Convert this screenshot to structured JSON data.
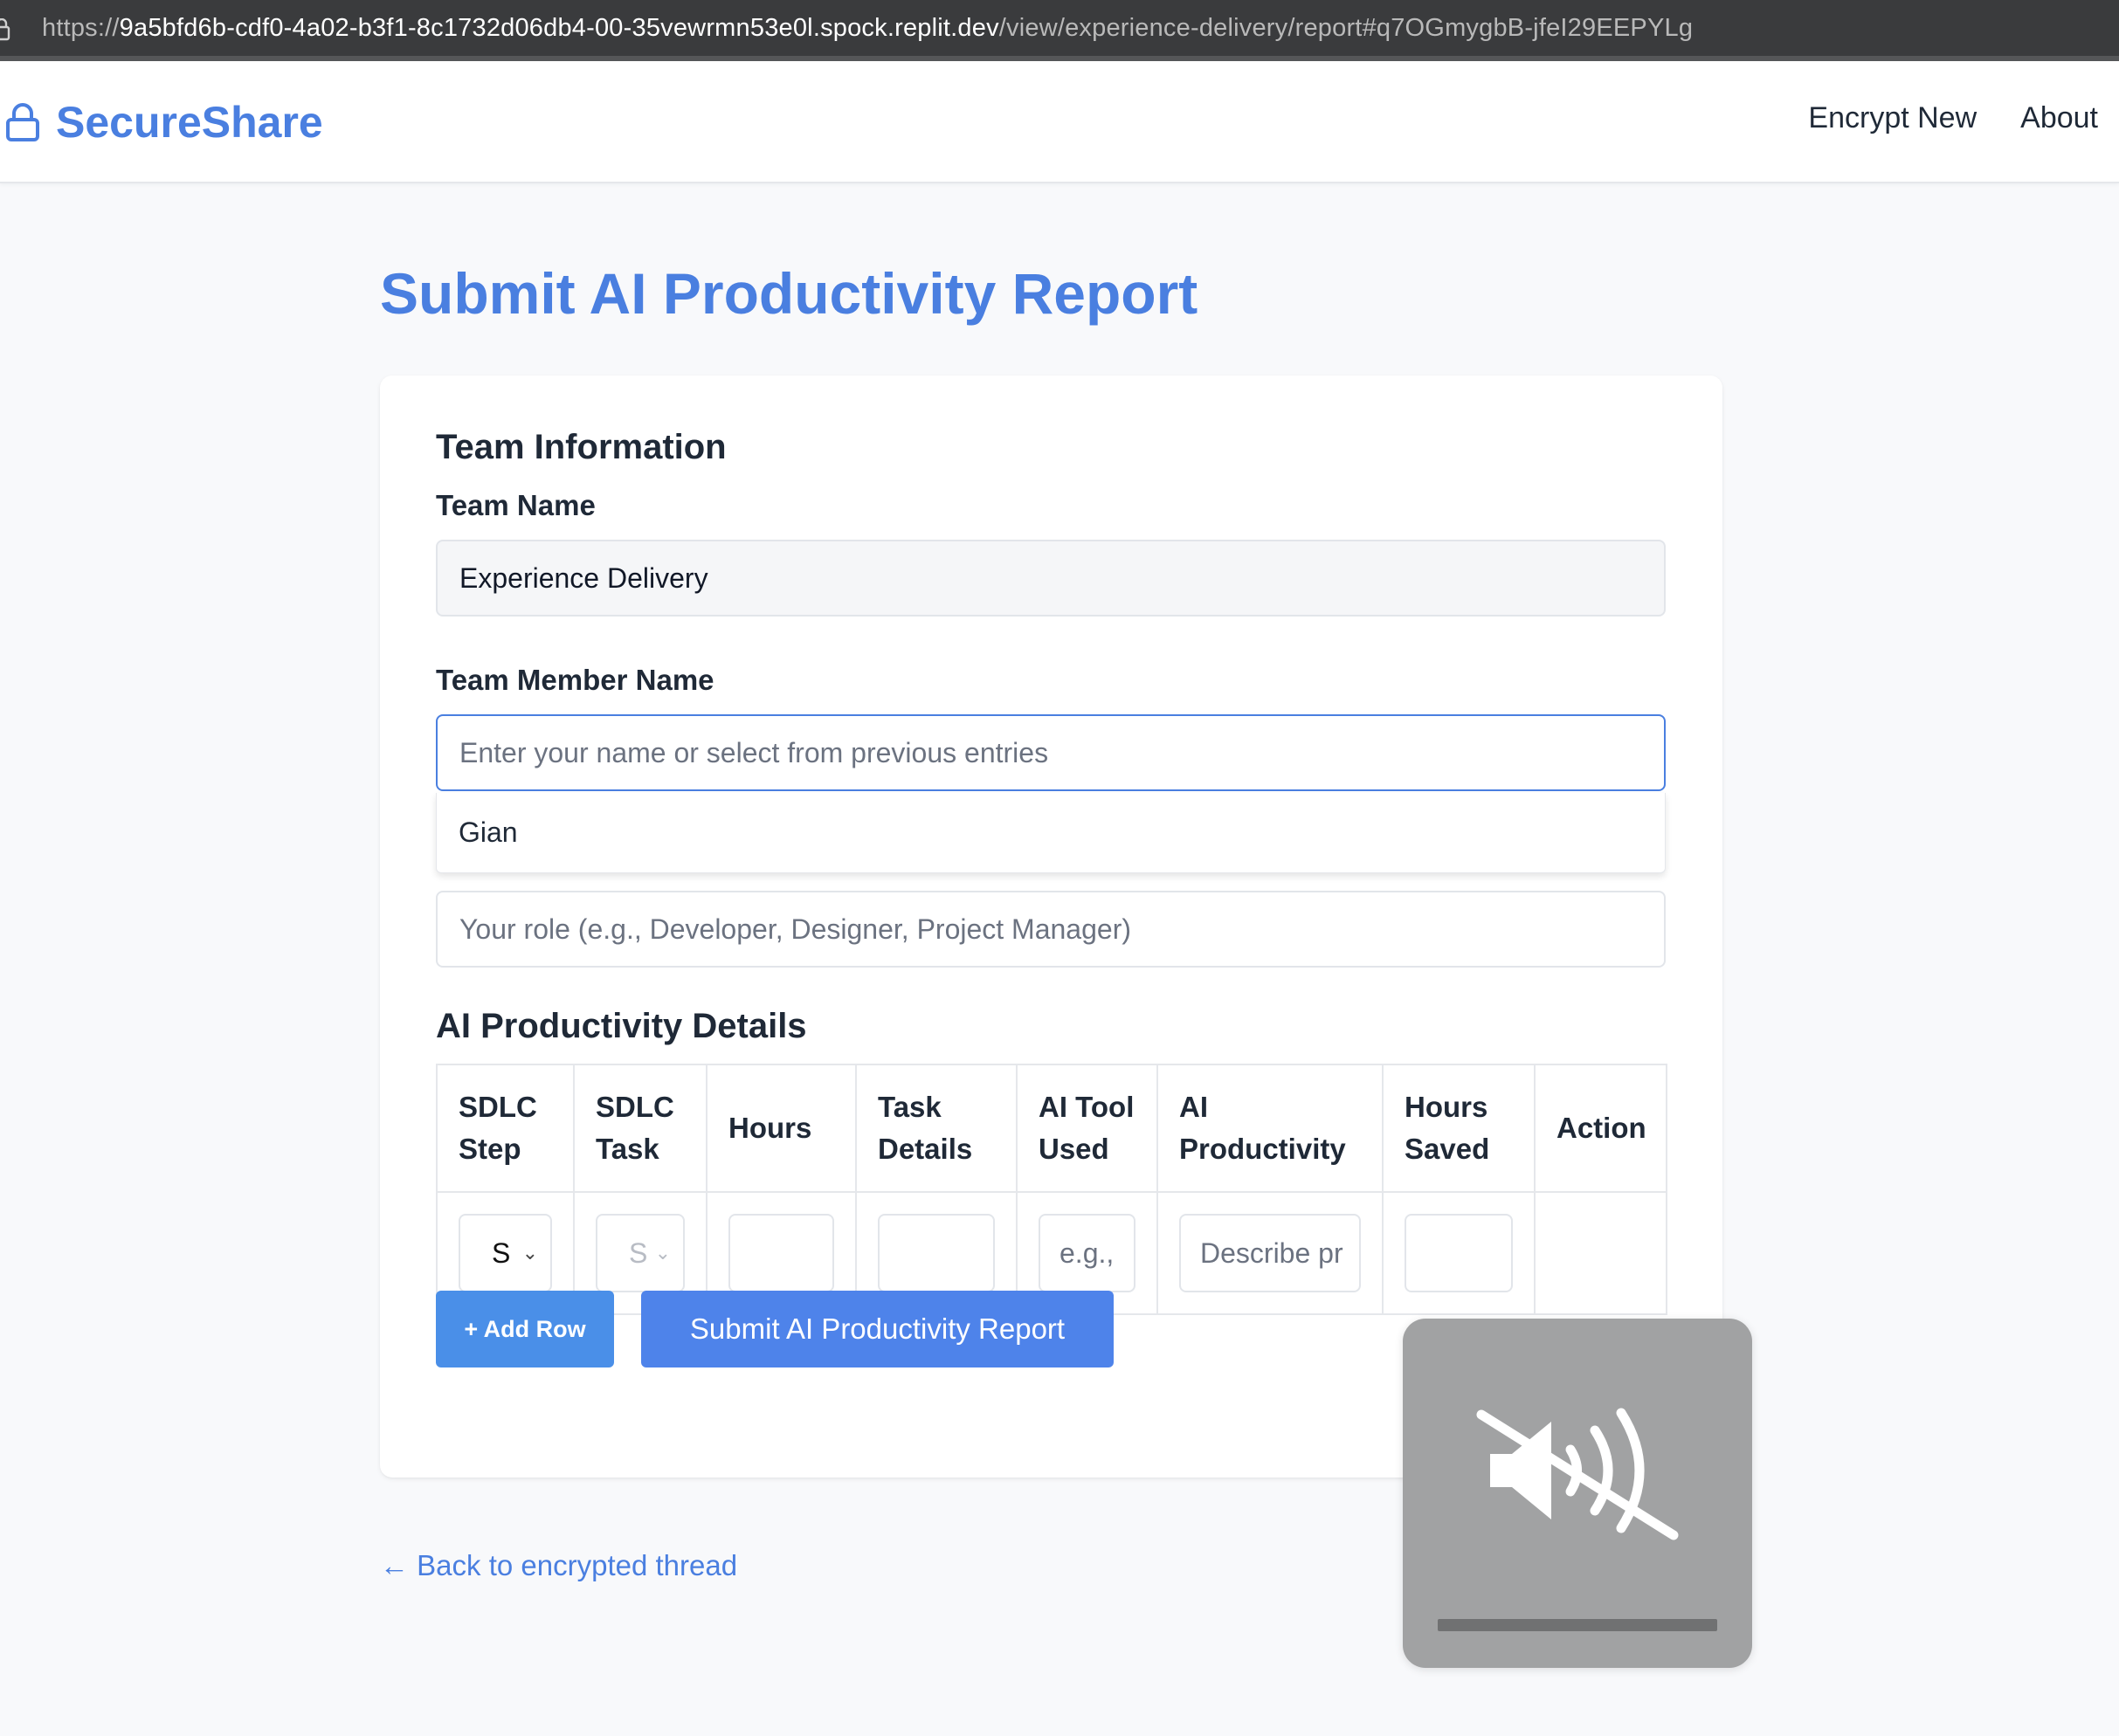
{
  "browser": {
    "url_proto": "https://",
    "url_host": "9a5bfd6b-cdf0-4a02-b3f1-8c1732d06db4-00-35vewrmn53e0l.spock.replit.dev",
    "url_path": "/view/experience-delivery/report#q7OGmygbB-jfeI29EEPYLg"
  },
  "nav": {
    "brand": "SecureShare",
    "links": [
      "Encrypt New",
      "About"
    ]
  },
  "page": {
    "title": "Submit AI Productivity Report"
  },
  "team_info": {
    "section_title": "Team Information",
    "team_name_label": "Team Name",
    "team_name_value": "Experience Delivery",
    "member_label": "Team Member Name",
    "member_placeholder": "Enter your name or select from previous entries",
    "member_suggestions": [
      "Gian"
    ],
    "role_placeholder": "Your role (e.g., Developer, Designer, Project Manager)"
  },
  "details": {
    "section_title": "AI Productivity Details",
    "columns": [
      [
        "SDLC",
        "Step"
      ],
      [
        "SDLC",
        "Task"
      ],
      [
        "Hours"
      ],
      [
        "Task",
        "Details"
      ],
      [
        "AI Tool",
        "Used"
      ],
      [
        "AI",
        "Productivity"
      ],
      [
        "Hours",
        "Saved"
      ],
      [
        "Action"
      ]
    ],
    "row": {
      "sdlc_step": "S",
      "sdlc_task": "S",
      "ai_tool_placeholder": "e.g.,",
      "productivity_placeholder": "Describe pr"
    }
  },
  "actions": {
    "add_row": "+ Add Row",
    "submit": "Submit AI Productivity Report",
    "back": "← Back to encrypted thread"
  },
  "colors": {
    "accent": "#4a7fe0",
    "button_add": "#4a8fe8",
    "button_submit": "#4e83ea",
    "osd_bg": "#a1a2a3"
  },
  "icons": {
    "brand": "lock-icon",
    "osd": "speaker-muted-icon"
  }
}
